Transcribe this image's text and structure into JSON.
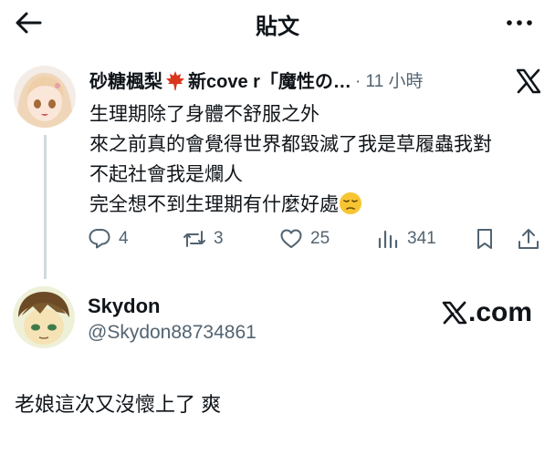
{
  "header": {
    "title": "貼文"
  },
  "post": {
    "display_name": "砂糖楓梨",
    "display_name_suffix": "新cove r「魔性の…",
    "time": "· 11 小時",
    "lines": [
      "生理期除了身體不舒服之外",
      "來之前真的會覺得世界都毀滅了我是草履蟲我對",
      "不起社會我是爛人",
      "完全想不到生理期有什麼好處"
    ],
    "actions": {
      "replies": "4",
      "reposts": "3",
      "likes": "25",
      "views": "341"
    }
  },
  "reply": {
    "name": "Skydon",
    "handle": "@Skydon88734861",
    "watermark": ".com",
    "text": "老娘這次又沒懷上了 爽"
  },
  "colors": {
    "text": "#0f1419",
    "secondary": "#536471",
    "thread_line": "#cfd9de"
  }
}
